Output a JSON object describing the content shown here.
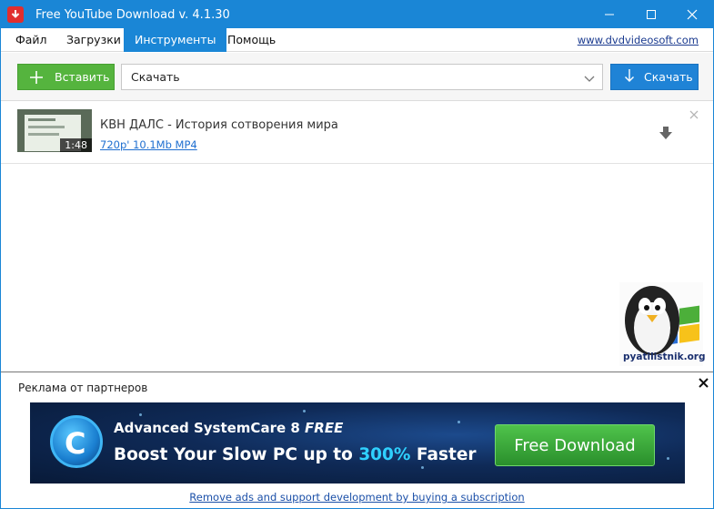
{
  "window": {
    "title": "Free YouTube Download v. 4.1.30",
    "accent_color": "#1a86d6"
  },
  "menu": {
    "items": [
      {
        "label": "Файл"
      },
      {
        "label": "Загрузки"
      },
      {
        "label": "Инструменты",
        "active": true
      },
      {
        "label": "Помощь"
      }
    ],
    "website_link": "www.dvdvideosoft.com"
  },
  "toolbar": {
    "paste_label": "Вставить",
    "action_select_value": "Скачать",
    "download_label": "Скачать",
    "paste_color": "#55b43e",
    "download_color": "#1f83d6"
  },
  "downloads": [
    {
      "title": "КВН ДАЛС - История сотворения мира",
      "duration": "1:48",
      "format": "720p' 10.1Mb MP4"
    }
  ],
  "ad": {
    "section_label": "Реклама от партнеров",
    "banner_product": "Advanced SystemCare 8",
    "banner_product_tag": "FREE",
    "banner_slogan_before": "Boost Your Slow PC up to",
    "banner_slogan_percent": "300%",
    "banner_slogan_after": "Faster",
    "banner_button": "Free Download",
    "footer_link": "Remove ads and support development by buying a subscription"
  },
  "watermark": {
    "text": "pyatilistnik.org"
  }
}
